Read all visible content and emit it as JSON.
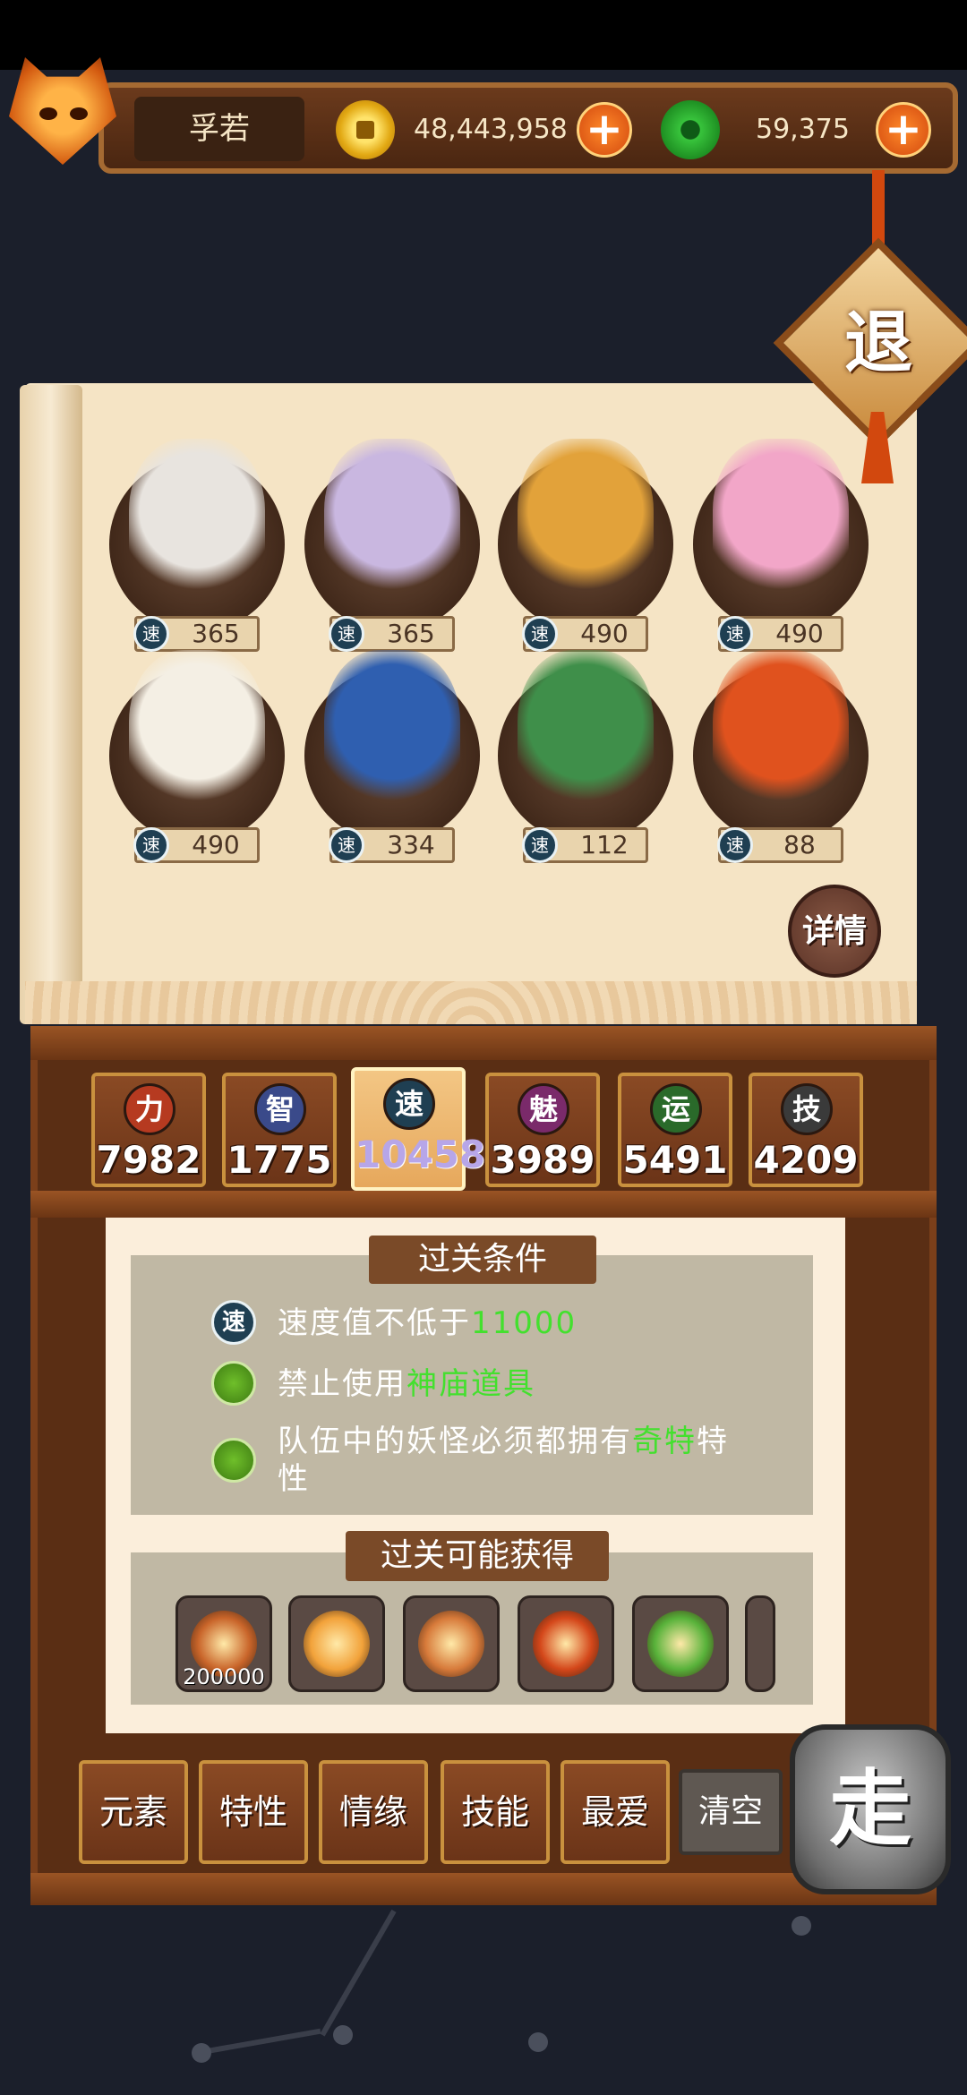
{
  "player": {
    "name": "孚若"
  },
  "currency": {
    "gold": "48,443,958",
    "jade": "59,375",
    "add_symbol": "+"
  },
  "exit_button": {
    "label": "退"
  },
  "monsters": [
    {
      "speed_icon": "速",
      "speed": "365",
      "color": "#e8e4df"
    },
    {
      "speed_icon": "速",
      "speed": "365",
      "color": "#c9b7e0"
    },
    {
      "speed_icon": "速",
      "speed": "490",
      "color": "#e2a23a"
    },
    {
      "speed_icon": "速",
      "speed": "490",
      "color": "#f2a6c8"
    },
    {
      "speed_icon": "速",
      "speed": "490",
      "color": "#f4efe4"
    },
    {
      "speed_icon": "速",
      "speed": "334",
      "color": "#2f5fb0"
    },
    {
      "speed_icon": "速",
      "speed": "112",
      "color": "#3f8f4a"
    },
    {
      "speed_icon": "速",
      "speed": "88",
      "color": "#e0521e"
    }
  ],
  "detail_button": {
    "label": "详情"
  },
  "stats": [
    {
      "icon": "力",
      "value": "7982",
      "icon_color": "#b63a20",
      "active": false
    },
    {
      "icon": "智",
      "value": "1775",
      "icon_color": "#3a4a8a",
      "active": false
    },
    {
      "icon": "速",
      "value": "10458",
      "icon_color": "#1f3f52",
      "active": true
    },
    {
      "icon": "魅",
      "value": "3989",
      "icon_color": "#7a2a6a",
      "active": false
    },
    {
      "icon": "运",
      "value": "5491",
      "icon_color": "#2a6a2a",
      "active": false
    },
    {
      "icon": "技",
      "value": "4209",
      "icon_color": "#3a3a3a",
      "active": false
    }
  ],
  "conditions": {
    "title": "过关条件",
    "items": [
      {
        "icon": "速",
        "text": "速度值不低于",
        "highlight": "11000",
        "suffix": ""
      },
      {
        "icon": "",
        "text": "禁止使用",
        "highlight": "神庙道具",
        "suffix": ""
      },
      {
        "icon": "",
        "text": "队伍中的妖怪必须都拥有",
        "highlight": "奇特",
        "suffix": "特",
        "line2": "性"
      }
    ]
  },
  "rewards": {
    "title": "过关可能获得",
    "items": [
      {
        "name": "gold-bag",
        "count": "200000",
        "color": "#c9652a"
      },
      {
        "name": "compass-orb",
        "count": "",
        "color": "#f2a23a"
      },
      {
        "name": "swirl-orb",
        "count": "",
        "color": "#d77a3a"
      },
      {
        "name": "fire-orb",
        "count": "",
        "color": "#d4471a"
      },
      {
        "name": "clover-orb",
        "count": "",
        "color": "#58b23a"
      }
    ]
  },
  "filters": [
    "元素",
    "特性",
    "情缘",
    "技能",
    "最爱"
  ],
  "clear_button": {
    "label": "清空"
  },
  "go_button": {
    "label": "走"
  }
}
